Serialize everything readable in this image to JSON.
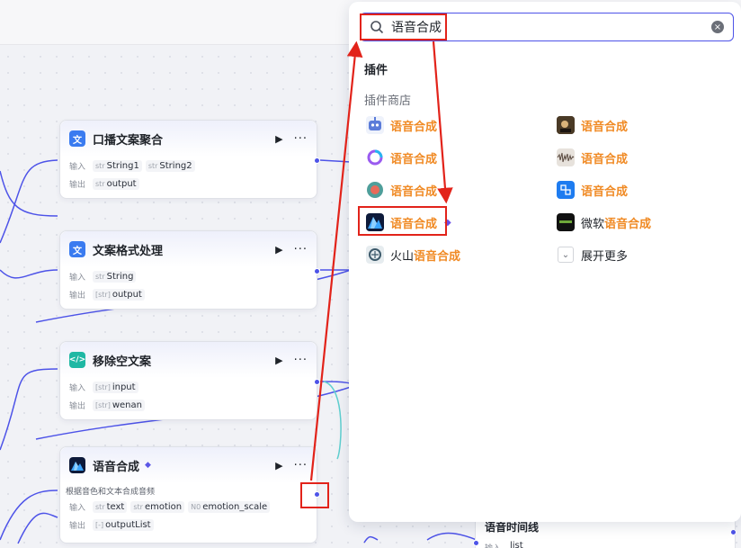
{
  "canvas": {
    "nodes": [
      {
        "title": "口播文案聚合",
        "icon": "translate-icon",
        "input_label": "输入",
        "output_label": "输出",
        "inputs": [
          {
            "type": "str",
            "name": "String1"
          },
          {
            "type": "str",
            "name": "String2"
          }
        ],
        "outputs": [
          {
            "type": "str",
            "name": "output"
          }
        ]
      },
      {
        "title": "文案格式处理",
        "icon": "translate-icon",
        "input_label": "输入",
        "output_label": "输出",
        "inputs": [
          {
            "type": "str",
            "name": "String"
          }
        ],
        "outputs": [
          {
            "type": "[str]",
            "name": "output"
          }
        ]
      },
      {
        "title": "移除空文案",
        "icon": "code-icon",
        "input_label": "输入",
        "output_label": "输出",
        "inputs": [
          {
            "type": "[str]",
            "name": "input"
          }
        ],
        "outputs": [
          {
            "type": "[str]",
            "name": "wenan"
          }
        ]
      },
      {
        "title": "语音合成",
        "icon": "mountain-icon",
        "description": "根据音色和文本合成音频",
        "input_label": "输入",
        "output_label": "输出",
        "inputs": [
          {
            "type": "str",
            "name": "text"
          },
          {
            "type": "str",
            "name": "emotion"
          },
          {
            "type": "N0",
            "name": "emotion_scale"
          }
        ],
        "outputs": [
          {
            "type": "[-]",
            "name": "outputList"
          }
        ]
      }
    ],
    "partial_node_title": "语音时间线",
    "partial_node_input_label": "输入",
    "partial_node_param": "list"
  },
  "panel": {
    "search_value": "语音合成",
    "section_plugins": "插件",
    "section_store": "插件商店",
    "items_left": [
      {
        "icon": "robot-icon",
        "prefix": "",
        "label": "语音合成"
      },
      {
        "icon": "ring-icon",
        "prefix": "",
        "label": "语音合成"
      },
      {
        "icon": "teal-circle-icon",
        "prefix": "",
        "label": "语音合成"
      },
      {
        "icon": "mountain-icon",
        "prefix": "",
        "label": "语音合成",
        "badge": "gem-icon"
      },
      {
        "icon": "brain-icon",
        "prefix": "火山",
        "label": "语音合成"
      }
    ],
    "items_right": [
      {
        "icon": "photo-icon",
        "prefix": "",
        "label": "语音合成"
      },
      {
        "icon": "waveform-icon",
        "prefix": "",
        "label": "语音合成"
      },
      {
        "icon": "blue-app-icon",
        "prefix": "",
        "label": "语音合成"
      },
      {
        "icon": "dark-app-icon",
        "prefix": "微软",
        "label": "语音合成"
      }
    ],
    "expand_more": "展开更多"
  },
  "colors": {
    "accent": "#4d53e8",
    "highlight": "#f08a24",
    "annotation": "#e2231a"
  }
}
